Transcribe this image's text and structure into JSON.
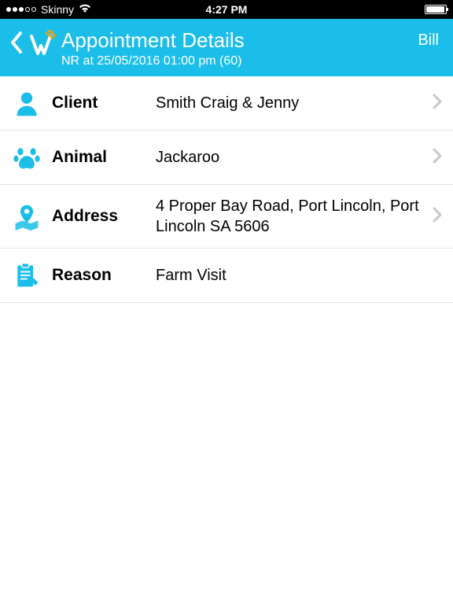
{
  "statusBar": {
    "carrier": "Skinny",
    "time": "4:27 PM"
  },
  "header": {
    "title": "Appointment Details",
    "subtitle": "NR at 25/05/2016 01:00 pm (60)",
    "action": "Bill"
  },
  "rows": {
    "client": {
      "label": "Client",
      "value": "Smith Craig & Jenny"
    },
    "animal": {
      "label": "Animal",
      "value": "Jackaroo"
    },
    "address": {
      "label": "Address",
      "value": "4 Proper Bay Road, Port Lincoln, Port Lincoln SA 5606"
    },
    "reason": {
      "label": "Reason",
      "value": "Farm Visit"
    }
  },
  "colors": {
    "accent": "#1BBEE8"
  }
}
